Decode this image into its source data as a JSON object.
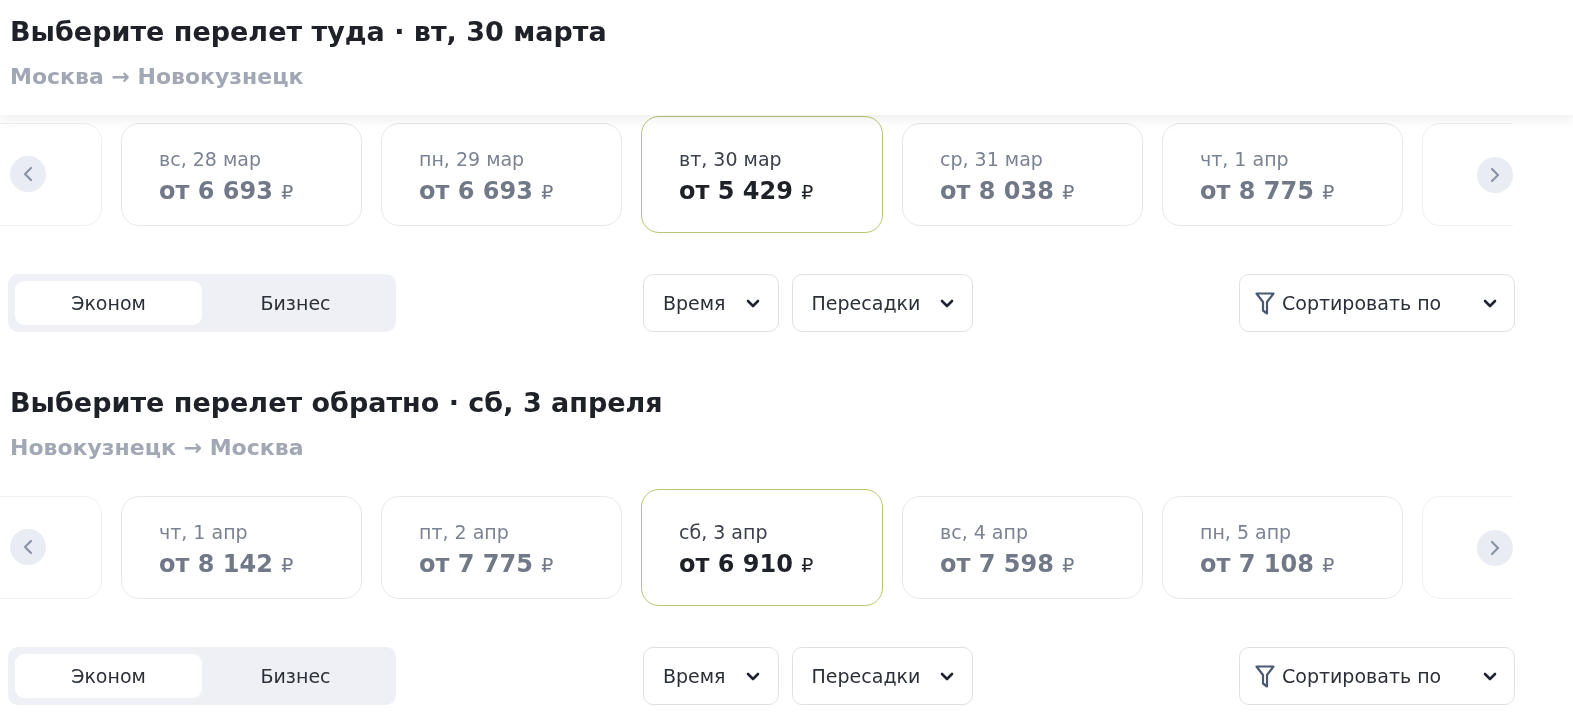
{
  "sections": [
    {
      "pinned": true,
      "title": "Выберите перелет туда · вт, 30 марта",
      "route": "Москва → Новокузнецк",
      "dates": [
        {
          "day": "вс, 28 мар",
          "price": "от 6 693",
          "currency": "₽",
          "selected": false
        },
        {
          "day": "пн, 29 мар",
          "price": "от 6 693",
          "currency": "₽",
          "selected": false
        },
        {
          "day": "вт, 30 мар",
          "price": "от 5 429",
          "currency": "₽",
          "selected": true
        },
        {
          "day": "ср, 31 мар",
          "price": "от 8 038",
          "currency": "₽",
          "selected": false
        },
        {
          "day": "чт, 1 апр",
          "price": "от 8 775",
          "currency": "₽",
          "selected": false
        }
      ],
      "cabin_classes": [
        {
          "label": "Эконом",
          "selected": true
        },
        {
          "label": "Бизнес",
          "selected": false
        }
      ],
      "filters": [
        {
          "label": "Время"
        },
        {
          "label": "Пересадки"
        }
      ],
      "sort": {
        "label": "Сортировать по"
      }
    },
    {
      "pinned": false,
      "title": "Выберите перелет обратно · сб, 3 апреля",
      "route": "Новокузнецк → Москва",
      "dates": [
        {
          "day": "чт, 1 апр",
          "price": "от 8 142",
          "currency": "₽",
          "selected": false
        },
        {
          "day": "пт, 2 апр",
          "price": "от 7 775",
          "currency": "₽",
          "selected": false
        },
        {
          "day": "сб, 3 апр",
          "price": "от 6 910",
          "currency": "₽",
          "selected": true
        },
        {
          "day": "вс, 4 апр",
          "price": "от 7 598",
          "currency": "₽",
          "selected": false
        },
        {
          "day": "пн, 5 апр",
          "price": "от 7 108",
          "currency": "₽",
          "selected": false
        }
      ],
      "cabin_classes": [
        {
          "label": "Эконом",
          "selected": true
        },
        {
          "label": "Бизнес",
          "selected": false
        }
      ],
      "filters": [
        {
          "label": "Время"
        },
        {
          "label": "Пересадки"
        }
      ],
      "sort": {
        "label": "Сортировать по"
      }
    }
  ]
}
